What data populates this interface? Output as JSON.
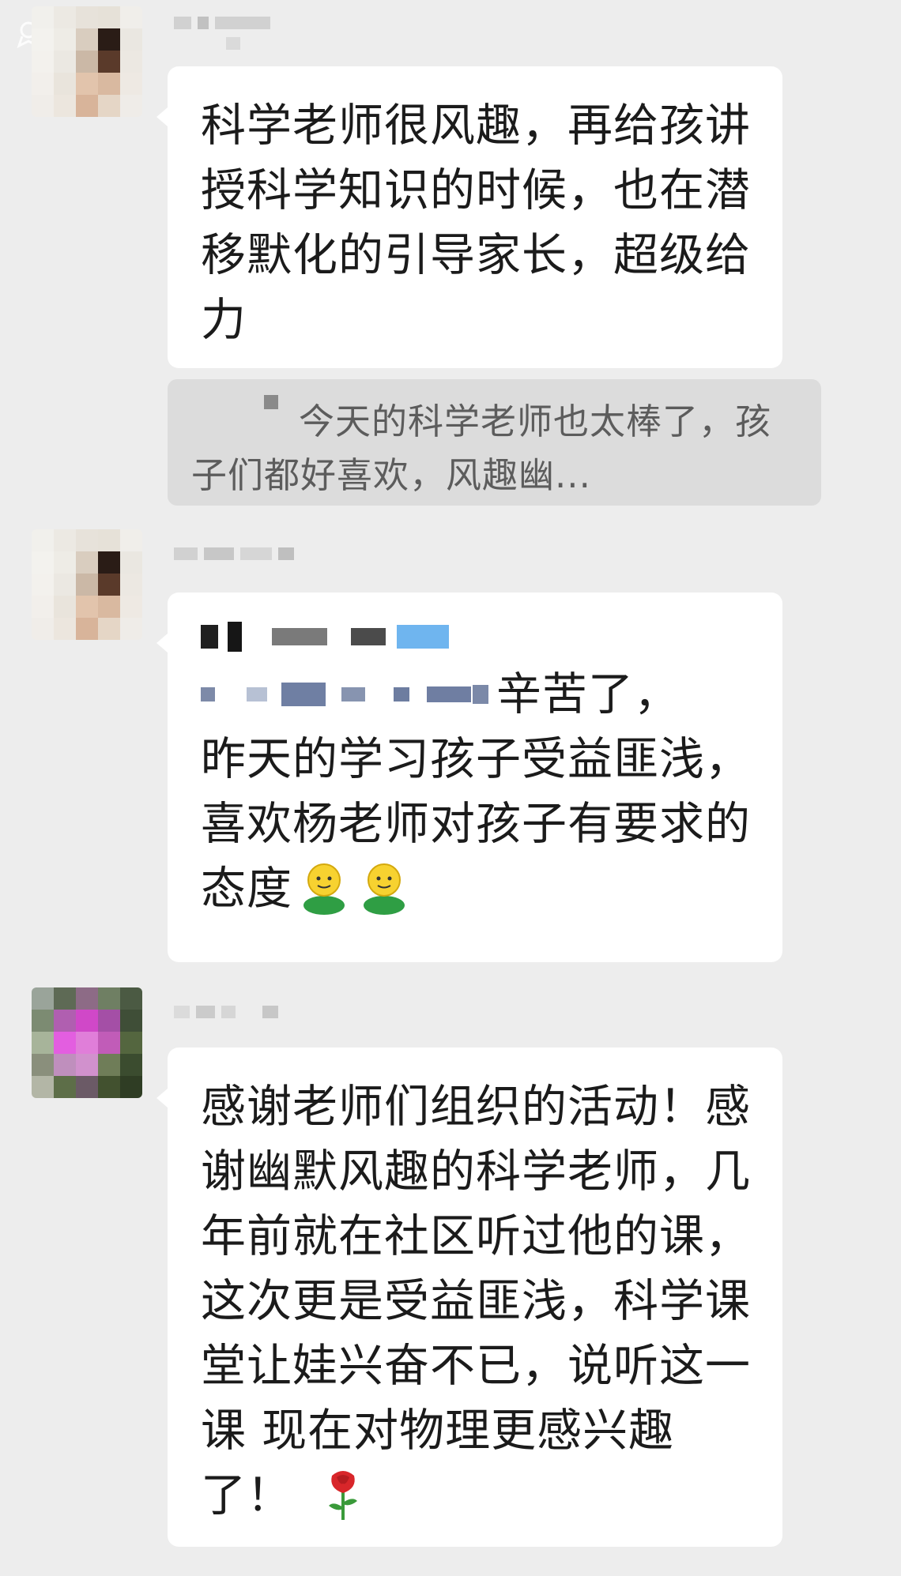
{
  "messages": [
    {
      "text": "科学老师很风趣，再给孩讲授科学知识的时候，也在潜移默化的引导家长，超级给力"
    },
    {
      "quote_text": "今天的科学老师也太棒了，孩子们都好喜欢，风趣幽..."
    },
    {
      "text_after_blur": "辛苦了，",
      "text": "昨天的学习孩子受益匪浅，喜欢杨老师对孩子有要求的态度",
      "emoji": [
        "smile-person-icon",
        "smile-person-icon"
      ]
    },
    {
      "text": "感谢老师们组织的活动！感谢幽默风趣的科学老师，几年前就在社区听过他的课，这次更是受益匪浅，科学课堂让娃兴奋不已，说听这一课 现在对物理更感兴趣了！",
      "emoji": "rose-icon"
    }
  ],
  "colors": {
    "background": "#ededed",
    "bubble": "#ffffff",
    "quote_background": "#dcdcdc",
    "text": "#1b1b1b",
    "quote_text": "#5c5c5c"
  }
}
